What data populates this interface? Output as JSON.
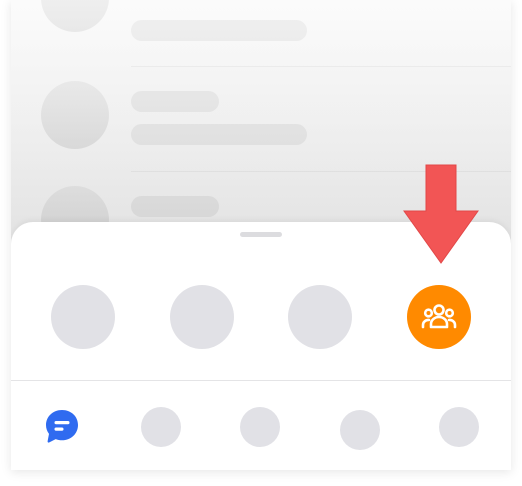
{
  "colors": {
    "accent": "#ff8a00",
    "chat_icon": "#2f6bf0",
    "arrow": "#f25555",
    "placeholder": "#e1e1e6"
  },
  "share_sheet": {
    "options": [
      {
        "icon": "placeholder"
      },
      {
        "icon": "placeholder"
      },
      {
        "icon": "placeholder"
      },
      {
        "icon": "group-icon",
        "selected": true
      }
    ]
  },
  "tab_bar": {
    "items": [
      {
        "icon": "chat-bubble-icon",
        "active": true
      },
      {
        "icon": "placeholder"
      },
      {
        "icon": "placeholder"
      },
      {
        "icon": "placeholder"
      },
      {
        "icon": "placeholder"
      }
    ]
  }
}
